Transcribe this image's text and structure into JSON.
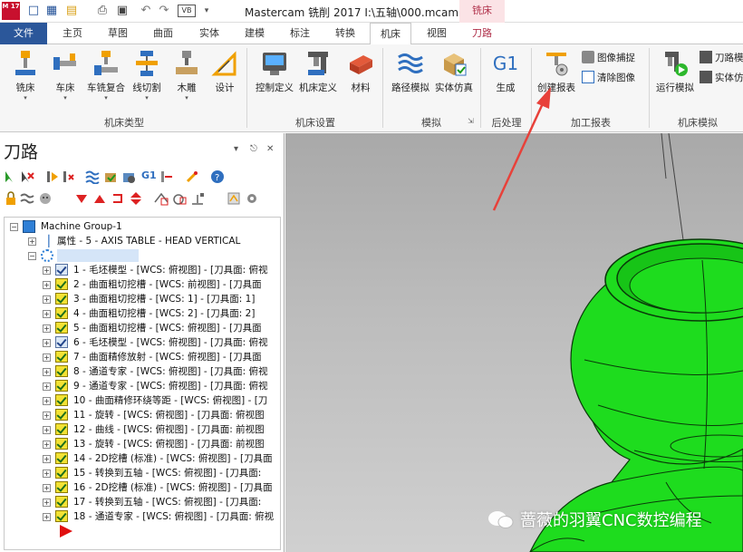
{
  "title": "Mastercam 铣削 2017  I:\\五轴\\000.mcam",
  "app_logo": "M 17",
  "context_group": "铣床",
  "tabs": [
    "文件",
    "主页",
    "草图",
    "曲面",
    "实体",
    "建模",
    "标注",
    "转换",
    "机床",
    "视图",
    "刀路"
  ],
  "active_tab": "机床",
  "ribbon": {
    "machine_type": {
      "label": "机床类型",
      "buttons": [
        "铣床",
        "车床",
        "车铣复合",
        "线切割",
        "木雕",
        "设计"
      ]
    },
    "machine_setup": {
      "label": "机床设置",
      "buttons": [
        "控制定义",
        "机床定义",
        "材料"
      ]
    },
    "simulate": {
      "label": "模拟",
      "buttons": [
        "路径模拟",
        "实体仿真"
      ]
    },
    "post": {
      "label": "后处理",
      "g1": "G1",
      "buttons": [
        "生成"
      ]
    },
    "report": {
      "label": "加工报表",
      "buttons": [
        "创建报表"
      ],
      "small": [
        "图像捕捉",
        "清除图像"
      ]
    },
    "machine_sim": {
      "label": "机床模拟",
      "buttons": [
        "运行模拟"
      ],
      "small": [
        "刀路模",
        "实体仿"
      ]
    }
  },
  "panel": {
    "title": "刀路",
    "pin": "▾  ᵼ  ✕",
    "tb_g1": "G1"
  },
  "tree": {
    "root": "Machine Group-1",
    "props": "属性 - 5 - AXIS TABLE - HEAD VERTICAL",
    "ops": [
      "1 - 毛坯模型 - [WCS: 俯视图] - [刀具面: 俯视",
      "2 - 曲面粗切挖槽 - [WCS: 前视图] - [刀具面",
      "3 - 曲面粗切挖槽 - [WCS: 1] - [刀具面: 1]",
      "4 - 曲面粗切挖槽 - [WCS: 2] - [刀具面: 2]",
      "5 - 曲面粗切挖槽 - [WCS: 俯视图] - [刀具面",
      "6 - 毛坯模型 - [WCS: 俯视图] - [刀具面: 俯视",
      "7 - 曲面精修放射 - [WCS: 俯视图] - [刀具面",
      "8 - 通道专家 - [WCS: 俯视图] - [刀具面: 俯视",
      "9 - 通道专家 - [WCS: 俯视图] - [刀具面: 俯视",
      "10 - 曲面精修环绕等距 - [WCS: 俯视图] - [刀",
      "11 - 旋转 - [WCS: 俯视图] - [刀具面: 俯视图",
      "12 - 曲线 - [WCS: 俯视图] - [刀具面: 前视图",
      "13 - 旋转 - [WCS: 俯视图] - [刀具面: 前视图",
      "14 - 2D挖槽 (标准) - [WCS: 俯视图] - [刀具面",
      "15 - 转换到五轴 - [WCS: 俯视图] - [刀具面:",
      "16 - 2D挖槽 (标准) - [WCS: 俯视图] - [刀具面",
      "17 - 转换到五轴 - [WCS: 俯视图] - [刀具面:",
      "18 - 通道专家 - [WCS: 俯视图] - [刀具面: 俯视"
    ]
  },
  "watermark": "蔷薇的羽翼CNC数控编程",
  "colors": {
    "file_tab": "#2b579a",
    "model": "#1edc1e",
    "arrow": "#e8413a"
  }
}
